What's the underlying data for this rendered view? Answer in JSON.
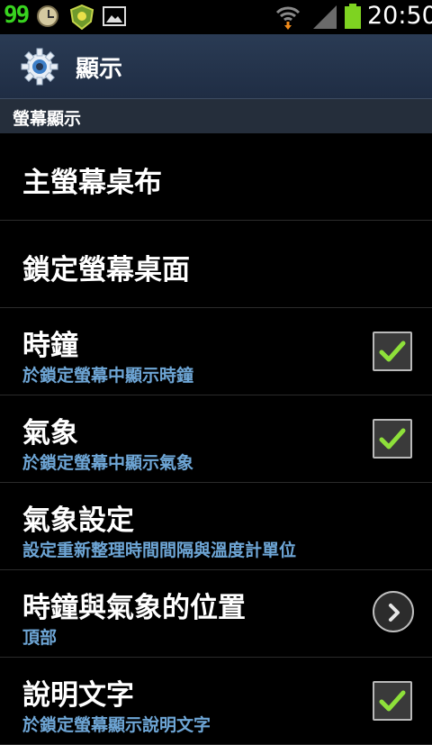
{
  "status_bar": {
    "notification_count": "99",
    "time": "20:50",
    "icons": [
      "clock-icon",
      "shield-icon",
      "image-icon",
      "wifi-icon",
      "signal-icon",
      "battery-icon"
    ]
  },
  "title_bar": {
    "title": "顯示",
    "icon": "gear-icon"
  },
  "section_header": "螢幕顯示",
  "items": [
    {
      "title": "主螢幕桌布"
    },
    {
      "title": "鎖定螢幕桌面"
    },
    {
      "title": "時鐘",
      "subtitle": "於鎖定螢幕中顯示時鐘",
      "checked": true
    },
    {
      "title": "氣象",
      "subtitle": "於鎖定螢幕中顯示氣象",
      "checked": true
    },
    {
      "title": "氣象設定",
      "subtitle": "設定重新整理時間間隔與溫度計單位"
    },
    {
      "title": "時鐘與氣象的位置",
      "subtitle": "頂部"
    },
    {
      "title": "說明文字",
      "subtitle": "於鎖定螢幕顯示說明文字",
      "checked": true
    }
  ],
  "colors": {
    "accent_subtitle": "#6ea6d6",
    "check_green": "#8ee03a",
    "title_bar": "#243550"
  }
}
